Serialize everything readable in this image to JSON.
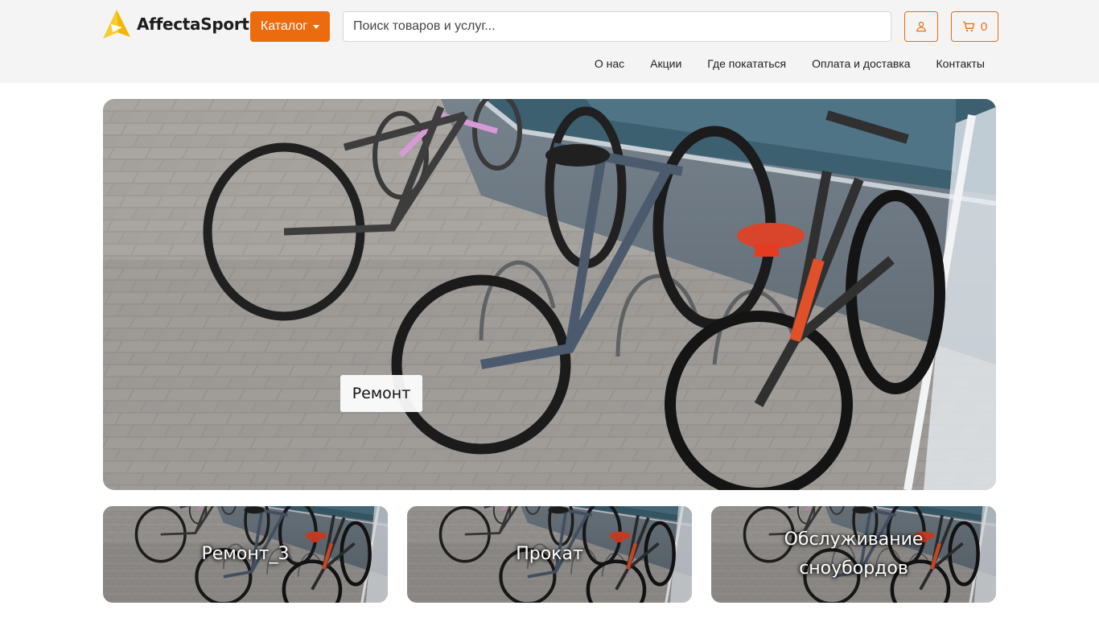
{
  "header": {
    "logo_text": "AffectaSport",
    "catalog_label": "Каталог",
    "search": {
      "placeholder": "Поиск товаров и услуг..."
    },
    "cart_count": "0",
    "nav": [
      "О нас",
      "Акции",
      "Где покататься",
      "Оплата и доставка",
      "Контакты"
    ]
  },
  "hero": {
    "label": "Ремонт"
  },
  "cards": [
    {
      "title": "Ремонт_3"
    },
    {
      "title": "Прокат"
    },
    {
      "title": "Обслуживание сноубордов"
    }
  ],
  "colors": {
    "accent": "#ec6b0e",
    "header_bg": "#f4f4f4"
  },
  "icons": {
    "user": "user-icon",
    "cart": "cart-icon",
    "catalog": "chevron-down-icon"
  }
}
